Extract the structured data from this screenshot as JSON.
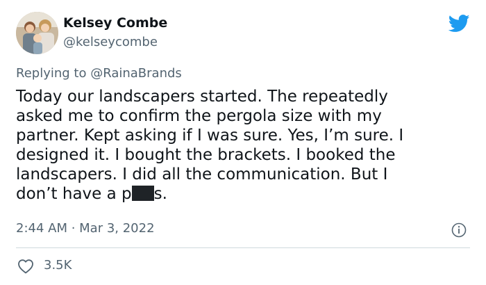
{
  "user": {
    "display_name": "Kelsey Combe",
    "handle": "@kelseycombe"
  },
  "reply": {
    "prefix": "Replying to ",
    "handle": "@RainaBrands"
  },
  "tweet": {
    "lines": [
      "Today our landscapers started. The repeatedly",
      "asked me to confirm the pergola size with my",
      "partner. Kept asking if I was sure. Yes, I’m sure. I",
      "designed it. I bought the brackets. I booked the",
      "landscapers. I did all the communication. But I"
    ],
    "last_line_before": "don’t have a p",
    "last_line_after": "s."
  },
  "meta": {
    "timestamp": "2:44 AM · Mar 3, 2022"
  },
  "engagement": {
    "likes": "3.5K"
  },
  "icons": {
    "brand": "twitter-bird-icon",
    "info": "info-icon",
    "like": "heart-icon"
  },
  "colors": {
    "brand": "#1d9bf0",
    "text": "#0f1419",
    "secondary": "#536471",
    "divider": "#cfd9de"
  }
}
